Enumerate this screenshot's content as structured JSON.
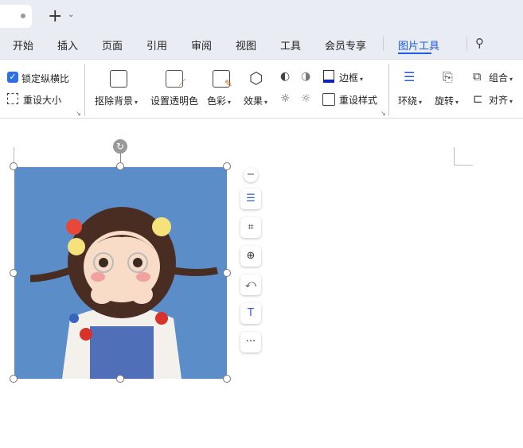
{
  "tabbar": {
    "new_tab_icon": "plus-icon",
    "dropdown_icon": "chevron-down-icon"
  },
  "menu": [
    "开始",
    "插入",
    "页面",
    "引用",
    "审阅",
    "视图",
    "工具",
    "会员专享",
    "图片工具"
  ],
  "active_menu": "图片工具",
  "ribbon": {
    "lock_ratio": "锁定纵横比",
    "lock_ratio_checked": true,
    "reset_size": "重设大小",
    "remove_bg": "抠除背景",
    "set_transparent": "设置透明色",
    "color": "色彩",
    "effects": "效果",
    "border": "边框",
    "reset_style": "重设样式",
    "wrap": "环绕",
    "rotate": "旋转",
    "group": "组合",
    "align": "对齐"
  },
  "side_toolbar": [
    "minus-icon",
    "wrap-text-icon",
    "crop-icon",
    "zoom-in-icon",
    "rotate-icon",
    "extract-text-icon",
    "more-icon"
  ],
  "colors": {
    "accent": "#1f5be0",
    "border_color": "#1020c0",
    "image_bg": "#5b8ec9"
  }
}
